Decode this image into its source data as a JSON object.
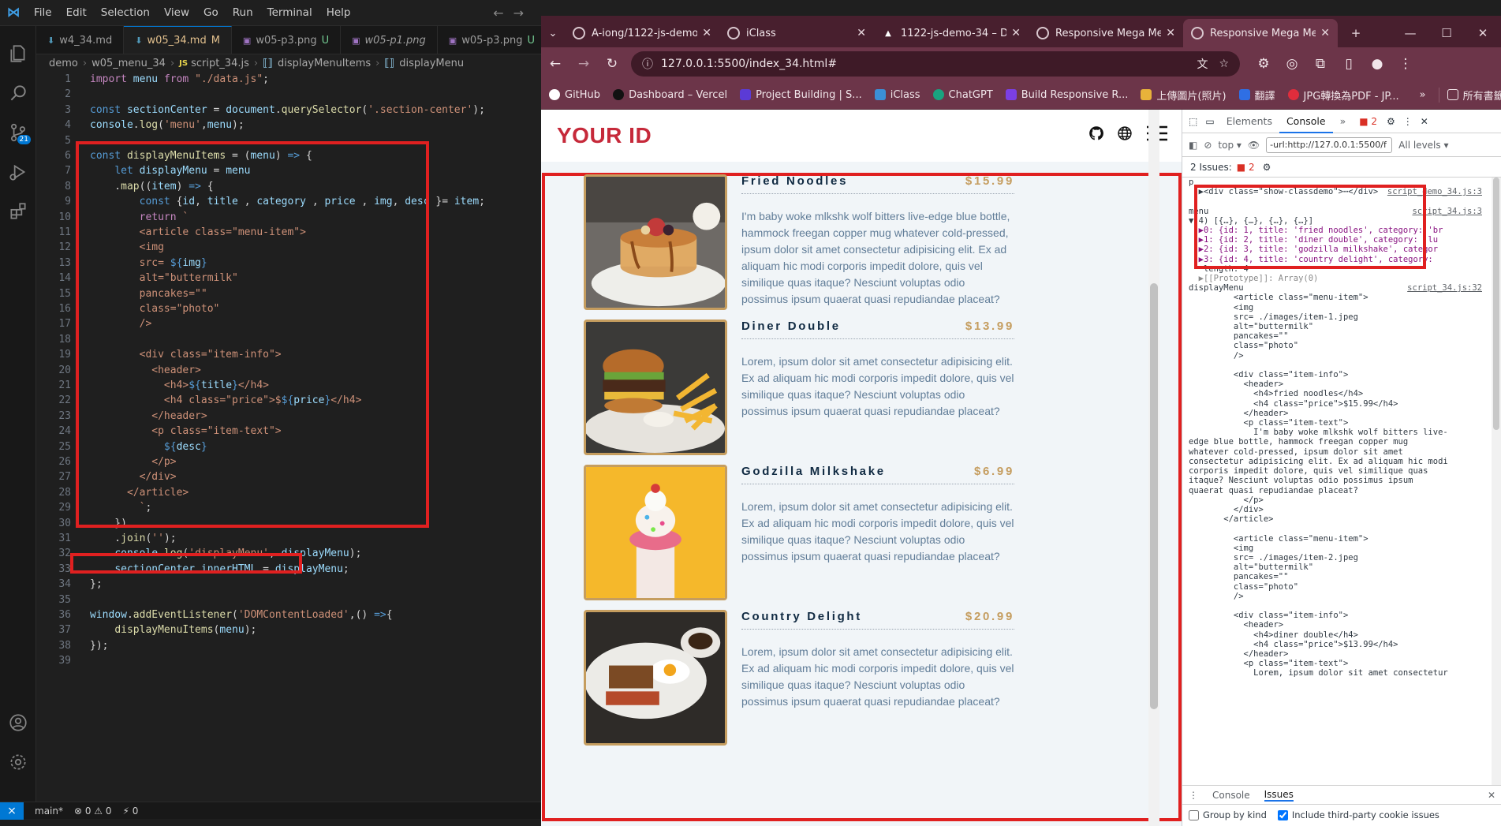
{
  "vscode": {
    "menu": [
      "File",
      "Edit",
      "Selection",
      "View",
      "Go",
      "Run",
      "Terminal",
      "Help"
    ],
    "tabs": [
      {
        "name": "w4_34.md",
        "status": "",
        "kind": "md"
      },
      {
        "name": "w05_34.md",
        "status": "M",
        "kind": "md"
      },
      {
        "name": "w05-p3.png",
        "status": "U",
        "kind": "png"
      },
      {
        "name": "w05-p1.png",
        "status": "",
        "kind": "png"
      },
      {
        "name": "w05-p3.png",
        "status": "U",
        "kind": "png"
      }
    ],
    "breadcrumb": {
      "a": "demo",
      "b": "w05_menu_34",
      "c": "script_34.js",
      "d": "displayMenuItems",
      "e": "displayMenu"
    },
    "scm_badge": "21",
    "status": {
      "branch": "main*",
      "problems": "⊗ 0 ⚠ 0",
      "ports": "⚡ 0"
    }
  },
  "chrome": {
    "tabs": [
      {
        "title": "A-iong/1122-js-demo-34"
      },
      {
        "title": "iClass"
      },
      {
        "title": "1122-js-demo-34 – D"
      },
      {
        "title": "Responsive Mega Me"
      },
      {
        "title": "Responsive Mega Me"
      }
    ],
    "url": "127.0.0.1:5500/index_34.html#",
    "bookmarks": [
      "GitHub",
      "Dashboard – Vercel",
      "Project Building | S...",
      "iClass",
      "ChatGPT",
      "Build Responsive R...",
      "上傳圖片(照片)",
      "翻譯",
      "JPG轉換為PDF - JP...",
      "所有書籤"
    ]
  },
  "page": {
    "brand": "YOUR ID",
    "items": [
      {
        "title": "Fried Noodles",
        "price": "$15.99",
        "desc": "I'm baby woke mlkshk wolf bitters live-edge blue bottle, hammock freegan copper mug whatever cold-pressed, ipsum dolor sit amet consectetur adipisicing elit. Ex ad aliquam hic modi corporis impedit dolore, quis vel similique quas itaque? Nesciunt voluptas odio possimus ipsum quaerat quasi repudiandae placeat?"
      },
      {
        "title": "Diner Double",
        "price": "$13.99",
        "desc": "Lorem, ipsum dolor sit amet consectetur adipisicing elit. Ex ad aliquam hic modi corporis impedit dolore, quis vel similique quas itaque? Nesciunt voluptas odio possimus ipsum quaerat quasi repudiandae placeat?"
      },
      {
        "title": "Godzilla Milkshake",
        "price": "$6.99",
        "desc": "Lorem, ipsum dolor sit amet consectetur adipisicing elit. Ex ad aliquam hic modi corporis impedit dolore, quis vel similique quas itaque? Nesciunt voluptas odio possimus ipsum quaerat quasi repudiandae placeat?"
      },
      {
        "title": "Country Delight",
        "price": "$20.99",
        "desc": "Lorem, ipsum dolor sit amet consectetur adipisicing elit. Ex ad aliquam hic modi corporis impedit dolore, quis vel similique quas itaque? Nesciunt voluptas odio possimus ipsum quaerat quasi repudiandae placeat?"
      }
    ]
  },
  "devtools": {
    "tabs": [
      "Elements",
      "Console"
    ],
    "error_count": "2",
    "context": "top",
    "filter": "-url:http://127.0.0.1:5500/f",
    "levels": "All levels",
    "issues_label": "2 Issues:",
    "drawer_tabs": [
      "Console",
      "Issues"
    ],
    "opt1": "Group by kind",
    "opt2": "Include third-party cookie issues"
  },
  "colors": {
    "accent": "#c6293a",
    "gold": "#c59d5f",
    "highlight": "#e02020"
  }
}
